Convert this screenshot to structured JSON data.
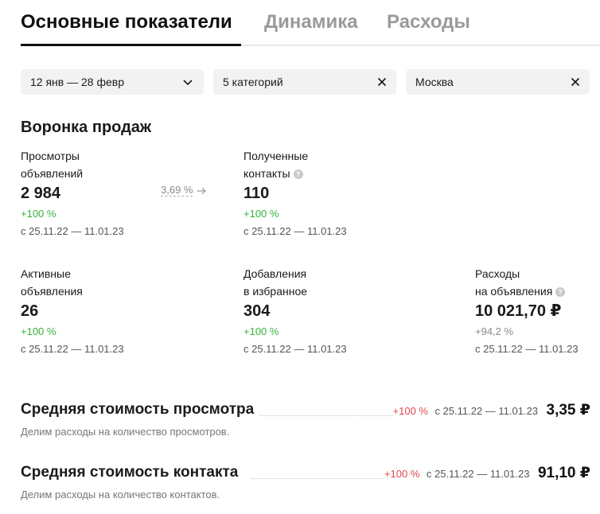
{
  "tabs": [
    {
      "label": "Основные показатели",
      "active": true
    },
    {
      "label": "Динамика",
      "active": false
    },
    {
      "label": "Расходы",
      "active": false
    }
  ],
  "filters": {
    "date": "12 янв — 28 февр",
    "categories": "5 категорий",
    "city": "Москва"
  },
  "funnel": {
    "title": "Воронка продаж",
    "conversion": "3,69 %",
    "metrics": [
      {
        "label1": "Просмотры",
        "label2": "объявлений",
        "value": "2 984",
        "change": "+100 %",
        "period": "с 25.11.22 — 11.01.23"
      },
      {
        "label1": "Полученные",
        "label2": "контакты",
        "value": "110",
        "change": "+100 %",
        "period": "с 25.11.22 — 11.01.23"
      },
      {
        "label1": "Активные",
        "label2": "объявления",
        "value": "26",
        "change": "+100 %",
        "period": "с 25.11.22 — 11.01.23"
      },
      {
        "label1": "Добавления",
        "label2": "в избранное",
        "value": "304",
        "change": "+100 %",
        "period": "с 25.11.22 — 11.01.23"
      },
      {
        "label1": "Расходы",
        "label2": "на объявления",
        "value": "10 021,70 ₽",
        "change": "+94,2 %",
        "period": "с 25.11.22 — 11.01.23"
      }
    ]
  },
  "averages": [
    {
      "title": "Средняя стоимость просмотра",
      "change": "+100 %",
      "period": "с 25.11.22 — 11.01.23",
      "value": "3,35 ₽",
      "description": "Делим расходы на количество просмотров."
    },
    {
      "title": "Средняя стоимость контакта",
      "change": "+100 %",
      "period": "с 25.11.22 — 11.01.23",
      "value": "91,10 ₽",
      "description": "Делим расходы на количество контактов."
    }
  ],
  "colors": {
    "positive": "#36b338",
    "negative": "#e0474c",
    "filter_bg": "#f2f2f2"
  },
  "icons": [
    "chevron-down-icon",
    "close-icon",
    "info-icon",
    "arrow-right-icon"
  ]
}
